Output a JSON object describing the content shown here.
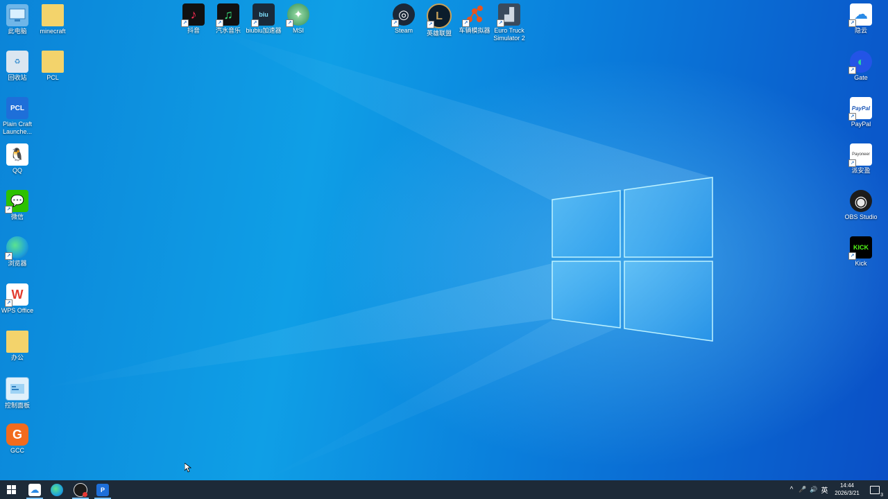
{
  "desktop": {
    "left_icons": [
      {
        "label": "此电脑",
        "icon": "computer-icon",
        "color": "#5aa9e6"
      },
      {
        "label": "minecraft",
        "icon": "folder-icon",
        "color": "#f3d36b"
      },
      {
        "label": "回收站",
        "icon": "recycle-bin-icon",
        "color": "#c9d6e3"
      },
      {
        "label": "PCL",
        "icon": "folder-icon",
        "color": "#f3d36b"
      },
      {
        "label": "Plain Craft Launche...",
        "icon": "pcl-launcher-icon",
        "color": "#1e6fd9",
        "glyph": "PCL"
      },
      {
        "label": "QQ",
        "icon": "qq-icon",
        "color": "#ffffff"
      },
      {
        "label": "微信",
        "icon": "wechat-icon",
        "color": "#2dc100"
      },
      {
        "label": "浏览器",
        "icon": "edge-icon",
        "color": "#1fa3d8"
      },
      {
        "label": "WPS Office",
        "icon": "wps-office-icon",
        "color": "#e23b2e",
        "glyph": "W"
      },
      {
        "label": "办公",
        "icon": "folder-icon",
        "color": "#f3d36b"
      },
      {
        "label": "控制面板",
        "icon": "control-panel-icon",
        "color": "#6fb6e8"
      },
      {
        "label": "GCC",
        "icon": "gcc-icon",
        "color": "#f26b1d",
        "glyph": "G"
      }
    ],
    "top_icons": [
      {
        "label": "抖音",
        "icon": "douyin-icon",
        "color": "#111111",
        "glyph": "♪"
      },
      {
        "label": "汽水音乐",
        "icon": "qishui-music-icon",
        "color": "#111111",
        "glyph": "♫"
      },
      {
        "label": "biubiu加速器",
        "icon": "biubiu-accelerator-icon",
        "color": "#1a2a3a",
        "glyph": "biu"
      },
      {
        "label": "MSI",
        "icon": "msi-icon",
        "color": "#2e8b57",
        "glyph": "✦"
      },
      {
        "label": "Steam",
        "icon": "steam-icon",
        "color": "#1b2838",
        "glyph": "◎"
      },
      {
        "label": "英雄联盟",
        "icon": "league-of-legends-icon",
        "color": "#0b1d2c",
        "glyph": "L"
      },
      {
        "label": "车辆模拟器",
        "icon": "vehicle-simulator-icon",
        "color": "#e8541d",
        "glyph": "●"
      },
      {
        "label": "Euro Truck Simulator 2",
        "icon": "euro-truck-icon",
        "color": "#3a4a5c",
        "glyph": "▟"
      }
    ],
    "right_icons": [
      {
        "label": "隐云",
        "icon": "cloud-icon",
        "color": "#ffffff",
        "glyph": "☁"
      },
      {
        "label": "Gate",
        "icon": "gate-icon",
        "color": "#2354e6",
        "glyph": "◐"
      },
      {
        "label": "PayPal",
        "icon": "paypal-icon",
        "color": "#ffffff",
        "glyph": "PayPal"
      },
      {
        "label": "派安盈",
        "icon": "payoneer-icon",
        "color": "#ffffff",
        "glyph": "Payoneer"
      },
      {
        "label": "OBS Studio",
        "icon": "obs-studio-icon",
        "color": "#1c1c1c",
        "glyph": "◉"
      },
      {
        "label": "Kick",
        "icon": "kick-icon",
        "color": "#000000",
        "glyph": "KICK"
      }
    ]
  },
  "taskbar": {
    "pinned": [
      {
        "name": "start",
        "icon": "windows-start-icon"
      },
      {
        "name": "yinyun",
        "icon": "cloud-icon"
      },
      {
        "name": "edge",
        "icon": "edge-icon"
      },
      {
        "name": "obs",
        "icon": "obs-studio-icon"
      },
      {
        "name": "pcl",
        "icon": "pcl-launcher-icon"
      }
    ],
    "tray": {
      "chevron": "^",
      "microphone": "🎤",
      "volume": "🔊",
      "ime": "英",
      "time": "14:44",
      "date": "2026/3/21",
      "notifications_count": "3"
    }
  }
}
